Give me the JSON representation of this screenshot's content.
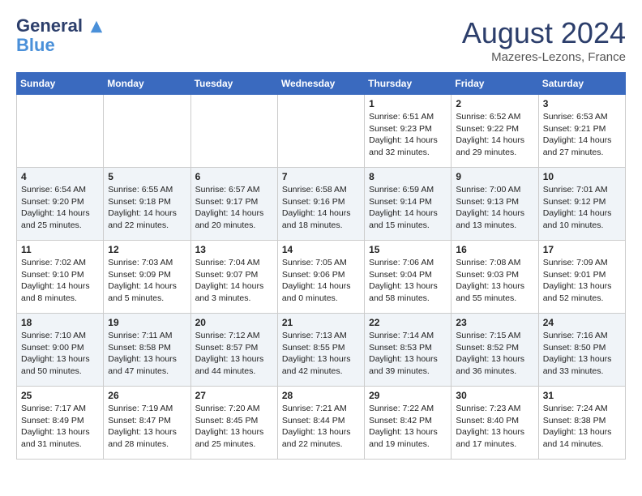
{
  "header": {
    "logo_line1": "General",
    "logo_line2": "Blue",
    "month_year": "August 2024",
    "location": "Mazeres-Lezons, France"
  },
  "weekdays": [
    "Sunday",
    "Monday",
    "Tuesday",
    "Wednesday",
    "Thursday",
    "Friday",
    "Saturday"
  ],
  "weeks": [
    [
      {
        "day": "",
        "info": ""
      },
      {
        "day": "",
        "info": ""
      },
      {
        "day": "",
        "info": ""
      },
      {
        "day": "",
        "info": ""
      },
      {
        "day": "1",
        "info": "Sunrise: 6:51 AM\nSunset: 9:23 PM\nDaylight: 14 hours\nand 32 minutes."
      },
      {
        "day": "2",
        "info": "Sunrise: 6:52 AM\nSunset: 9:22 PM\nDaylight: 14 hours\nand 29 minutes."
      },
      {
        "day": "3",
        "info": "Sunrise: 6:53 AM\nSunset: 9:21 PM\nDaylight: 14 hours\nand 27 minutes."
      }
    ],
    [
      {
        "day": "4",
        "info": "Sunrise: 6:54 AM\nSunset: 9:20 PM\nDaylight: 14 hours\nand 25 minutes."
      },
      {
        "day": "5",
        "info": "Sunrise: 6:55 AM\nSunset: 9:18 PM\nDaylight: 14 hours\nand 22 minutes."
      },
      {
        "day": "6",
        "info": "Sunrise: 6:57 AM\nSunset: 9:17 PM\nDaylight: 14 hours\nand 20 minutes."
      },
      {
        "day": "7",
        "info": "Sunrise: 6:58 AM\nSunset: 9:16 PM\nDaylight: 14 hours\nand 18 minutes."
      },
      {
        "day": "8",
        "info": "Sunrise: 6:59 AM\nSunset: 9:14 PM\nDaylight: 14 hours\nand 15 minutes."
      },
      {
        "day": "9",
        "info": "Sunrise: 7:00 AM\nSunset: 9:13 PM\nDaylight: 14 hours\nand 13 minutes."
      },
      {
        "day": "10",
        "info": "Sunrise: 7:01 AM\nSunset: 9:12 PM\nDaylight: 14 hours\nand 10 minutes."
      }
    ],
    [
      {
        "day": "11",
        "info": "Sunrise: 7:02 AM\nSunset: 9:10 PM\nDaylight: 14 hours\nand 8 minutes."
      },
      {
        "day": "12",
        "info": "Sunrise: 7:03 AM\nSunset: 9:09 PM\nDaylight: 14 hours\nand 5 minutes."
      },
      {
        "day": "13",
        "info": "Sunrise: 7:04 AM\nSunset: 9:07 PM\nDaylight: 14 hours\nand 3 minutes."
      },
      {
        "day": "14",
        "info": "Sunrise: 7:05 AM\nSunset: 9:06 PM\nDaylight: 14 hours\nand 0 minutes."
      },
      {
        "day": "15",
        "info": "Sunrise: 7:06 AM\nSunset: 9:04 PM\nDaylight: 13 hours\nand 58 minutes."
      },
      {
        "day": "16",
        "info": "Sunrise: 7:08 AM\nSunset: 9:03 PM\nDaylight: 13 hours\nand 55 minutes."
      },
      {
        "day": "17",
        "info": "Sunrise: 7:09 AM\nSunset: 9:01 PM\nDaylight: 13 hours\nand 52 minutes."
      }
    ],
    [
      {
        "day": "18",
        "info": "Sunrise: 7:10 AM\nSunset: 9:00 PM\nDaylight: 13 hours\nand 50 minutes."
      },
      {
        "day": "19",
        "info": "Sunrise: 7:11 AM\nSunset: 8:58 PM\nDaylight: 13 hours\nand 47 minutes."
      },
      {
        "day": "20",
        "info": "Sunrise: 7:12 AM\nSunset: 8:57 PM\nDaylight: 13 hours\nand 44 minutes."
      },
      {
        "day": "21",
        "info": "Sunrise: 7:13 AM\nSunset: 8:55 PM\nDaylight: 13 hours\nand 42 minutes."
      },
      {
        "day": "22",
        "info": "Sunrise: 7:14 AM\nSunset: 8:53 PM\nDaylight: 13 hours\nand 39 minutes."
      },
      {
        "day": "23",
        "info": "Sunrise: 7:15 AM\nSunset: 8:52 PM\nDaylight: 13 hours\nand 36 minutes."
      },
      {
        "day": "24",
        "info": "Sunrise: 7:16 AM\nSunset: 8:50 PM\nDaylight: 13 hours\nand 33 minutes."
      }
    ],
    [
      {
        "day": "25",
        "info": "Sunrise: 7:17 AM\nSunset: 8:49 PM\nDaylight: 13 hours\nand 31 minutes."
      },
      {
        "day": "26",
        "info": "Sunrise: 7:19 AM\nSunset: 8:47 PM\nDaylight: 13 hours\nand 28 minutes."
      },
      {
        "day": "27",
        "info": "Sunrise: 7:20 AM\nSunset: 8:45 PM\nDaylight: 13 hours\nand 25 minutes."
      },
      {
        "day": "28",
        "info": "Sunrise: 7:21 AM\nSunset: 8:44 PM\nDaylight: 13 hours\nand 22 minutes."
      },
      {
        "day": "29",
        "info": "Sunrise: 7:22 AM\nSunset: 8:42 PM\nDaylight: 13 hours\nand 19 minutes."
      },
      {
        "day": "30",
        "info": "Sunrise: 7:23 AM\nSunset: 8:40 PM\nDaylight: 13 hours\nand 17 minutes."
      },
      {
        "day": "31",
        "info": "Sunrise: 7:24 AM\nSunset: 8:38 PM\nDaylight: 13 hours\nand 14 minutes."
      }
    ]
  ]
}
